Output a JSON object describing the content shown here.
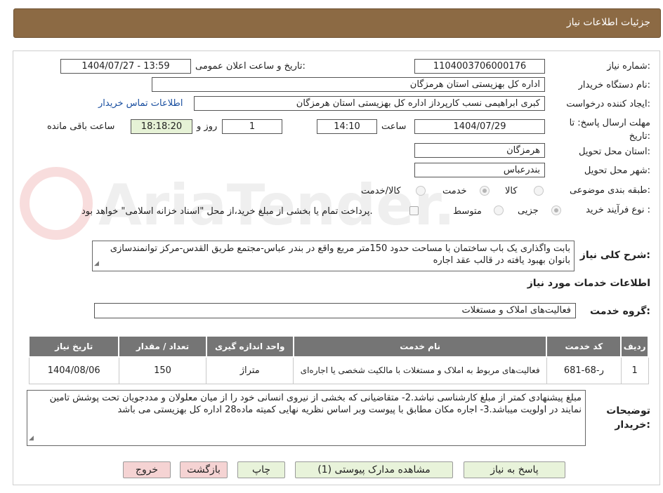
{
  "header": {
    "title": "جزئیات اطلاعات نیاز"
  },
  "labels": {
    "need_number": "شماره نیاز:",
    "announce_datetime": "تاریخ و ساعت اعلان عمومی:",
    "buyer_org": "نام دستگاه خریدار:",
    "requester": "ایجاد کننده درخواست:",
    "deadline": "مهلت ارسال پاسخ: تا تاریخ:",
    "hour": "ساعت",
    "day_and": "روز و",
    "remaining": "ساعت باقی مانده",
    "delivery_province": "استان محل تحویل:",
    "delivery_city": "شهر محل تحویل:",
    "category": "طبقه بندی موضوعی:",
    "purchase_type": "نوع فرآیند خرید :",
    "general_desc": "شرح کلی نیاز:",
    "services_info": "اطلاعات خدمات مورد نیاز",
    "service_group": "گروه خدمت:",
    "buyer_notes": "توضیحات خریدار:"
  },
  "fields": {
    "need_number": "1104003706000176",
    "announce_datetime": "1404/07/27 - 13:59",
    "buyer_org": "اداره کل بهزیستی استان هرمزگان",
    "requester": "کبری  ابراهیمی نسب کارپرداز اداره کل بهزیستی استان هرمزگان",
    "contact_link": "اطلاعات تماس خریدار",
    "deadline_date": "1404/07/29",
    "deadline_time": "14:10",
    "days": "1",
    "remaining_time": "18:18:20",
    "delivery_province": "هرمزگان",
    "delivery_city": "بندرعباس",
    "service_group": "فعالیت‌های  املاک و مستغلات"
  },
  "category_options": [
    "کالا",
    "خدمت",
    "کالا/خدمت"
  ],
  "category_selected": "خدمت",
  "purchase_options": [
    "جزیی",
    "متوسط"
  ],
  "purchase_selected": "جزیی",
  "treasury_note": "پرداخت تمام یا بخشی از مبلغ خرید،از محل \"اسناد خزانه اسلامی\" خواهد بود.",
  "general_desc": "بابت واگذاری یک باب ساختمان با مساحت حدود 150متر مربع واقع در بندر عباس-مجتمع طریق القدس-مرکز توانمندسازی بانوان بهبود یافته  در قالب عقد اجاره",
  "table": {
    "headers": [
      "ردیف",
      "کد خدمت",
      "نام خدمت",
      "واحد اندازه گیری",
      "تعداد / مقدار",
      "تاریخ نیاز"
    ],
    "rows": [
      [
        "1",
        "ر-68-681",
        "فعالیت‌های مربوط به املاک و مستغلات با مالکیت شخصی یا اجاره‌ای",
        "متراژ",
        "150",
        "1404/08/06"
      ]
    ]
  },
  "buyer_notes": "مبلغ پیشنهادی کمتر از مبلغ کارشناسی نباشد.2- متقاضیانی که بخشی از نیروی انسانی خود را از میان معلولان و مددجویان تحت پوشش تامین نمایند در اولویت میباشد.3-  اجاره مکان  مطابق با پیوست وبر اساس نظریه نهایی کمیته ماده28 اداره کل بهزیستی می باشد",
  "buttons": {
    "reply": "پاسخ به نیاز",
    "attachments": "مشاهده مدارک پیوستی (1)",
    "print": "چاپ",
    "back": "بازگشت",
    "exit": "خروج"
  },
  "watermark": "AriaTender.neT",
  "colors": {
    "header_bg": "#8c6a44",
    "table_header_bg": "#757575",
    "button_bg": "#e8f3da",
    "button_pink": "#f5d3d3",
    "timer_bg": "#e6f2d6",
    "link": "#1a4fa0"
  }
}
